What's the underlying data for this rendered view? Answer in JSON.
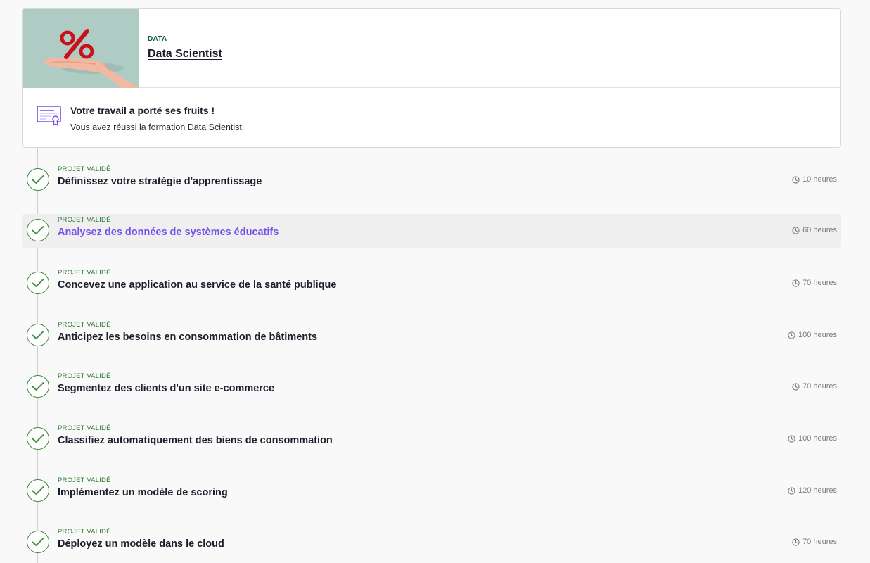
{
  "course": {
    "category": "DATA",
    "title": "Data Scientist"
  },
  "success": {
    "title": "Votre travail a porté ses fruits !",
    "subtitle": "Vous avez réussi la formation Data Scientist."
  },
  "projects": [
    {
      "status": "PROJET VALIDÉ",
      "title": "Définissez votre stratégie d'apprentissage",
      "duration": "10 heures"
    },
    {
      "status": "PROJET VALIDÉ",
      "title": "Analysez des données de systèmes éducatifs",
      "duration": "60 heures",
      "active": true
    },
    {
      "status": "PROJET VALIDÉ",
      "title": "Concevez une application au service de la santé publique",
      "duration": "70 heures"
    },
    {
      "status": "PROJET VALIDÉ",
      "title": "Anticipez les besoins en consommation de bâtiments",
      "duration": "100 heures"
    },
    {
      "status": "PROJET VALIDÉ",
      "title": "Segmentez des clients d'un site e-commerce",
      "duration": "70 heures"
    },
    {
      "status": "PROJET VALIDÉ",
      "title": "Classifiez automatiquement des biens de consommation",
      "duration": "100 heures"
    },
    {
      "status": "PROJET VALIDÉ",
      "title": "Implémentez un modèle de scoring",
      "duration": "120 heures"
    },
    {
      "status": "PROJET VALIDÉ",
      "title": "Déployez un modèle dans le cloud",
      "duration": "70 heures"
    }
  ],
  "icons": {
    "thumbnail": "percent-on-hand-icon",
    "success": "certificate-icon",
    "project_status": "check-circle-icon",
    "duration": "clock-icon"
  },
  "colors": {
    "accent": "#7451eb",
    "success": "#2f7d32",
    "category": "#0f5a4c"
  }
}
